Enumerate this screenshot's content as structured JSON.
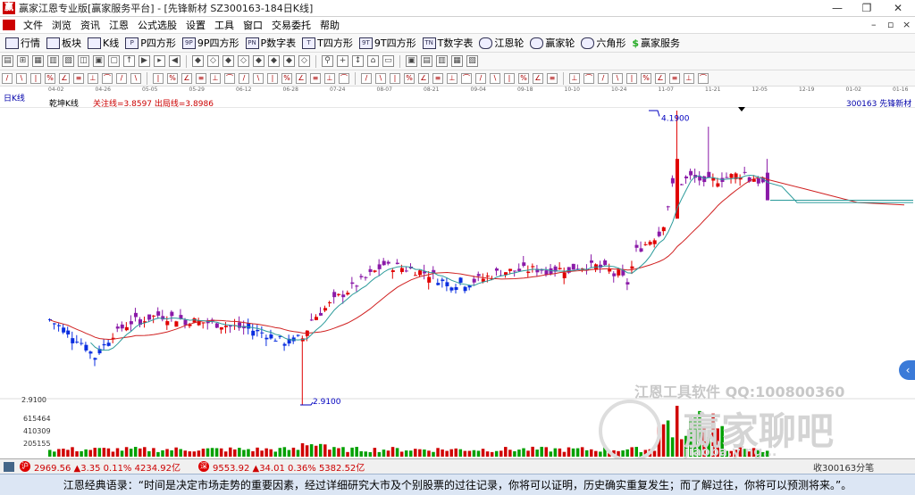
{
  "window": {
    "title": "赢家江恩专业版[赢家服务平台] - [先锋新材  SZ300163-184日K线]",
    "min": "—",
    "max": "❐",
    "close": "✕"
  },
  "menu": [
    "文件",
    "浏览",
    "资讯",
    "江恩",
    "公式选股",
    "设置",
    "工具",
    "窗口",
    "交易委托",
    "帮助"
  ],
  "toolbar": [
    {
      "icon": "grid-icon",
      "label": "行情"
    },
    {
      "icon": "blocks-icon",
      "label": "板块"
    },
    {
      "icon": "kline-icon",
      "label": "K线"
    },
    {
      "icon": "p-square-icon",
      "label": "P四方形"
    },
    {
      "icon": "9p-square-icon",
      "label": "9P四方形"
    },
    {
      "icon": "pn-table-icon",
      "label": "P数字表"
    },
    {
      "icon": "t-square-icon",
      "label": "T四方形"
    },
    {
      "icon": "9t-square-icon",
      "label": "9T四方形"
    },
    {
      "icon": "tn-table-icon",
      "label": "T数字表"
    },
    {
      "icon": "wheel-icon",
      "label": "江恩轮"
    },
    {
      "icon": "wheel-icon",
      "label": "赢家轮"
    },
    {
      "icon": "hexagon-icon",
      "label": "六角形"
    },
    {
      "icon": "dollar-icon",
      "label": "赢家服务"
    }
  ],
  "dates": [
    "04-02",
    "04-26",
    "05-05",
    "05-29",
    "06-12",
    "06-28",
    "07-24",
    "08-07",
    "08-21",
    "09-04",
    "09-18",
    "10-10",
    "10-24",
    "11-07",
    "11-21",
    "12-05",
    "12-19",
    "01-02",
    "01-16"
  ],
  "chart_label": "日K线",
  "indicator_name": "乾坤K线",
  "indicator_lines": "关注线=3.8597  出局线=3.8986",
  "stock": "300163  先锋新材",
  "high_label": "4.1900",
  "low_label": "2.9100",
  "price_axis_label": "2.9100",
  "volume_axis": [
    "615464",
    "410309",
    "205155"
  ],
  "watermark1": "江恩工具软件   QQ:100800360",
  "watermark2": "赢家聊吧",
  "watermark3": "jiaoba.ying...",
  "status": {
    "sh_icon": "沪",
    "sh": "2969.56 ▲3.35 0.11% 4234.92亿",
    "sz_icon": "深",
    "sz": "9553.92 ▲34.01 0.36% 5382.52亿",
    "right": "收300163分笔"
  },
  "quote": "江恩经典语录：“时间是决定市场走势的重要因素，经过详细研究大市及个别股票的过往记录，你将可以证明，历史确实重复发生；而了解过往，你将可以预测将来。”。",
  "chart_data": {
    "type": "candlestick",
    "price_range": [
      2.91,
      4.19
    ],
    "high": 4.19,
    "low": 2.91
  }
}
